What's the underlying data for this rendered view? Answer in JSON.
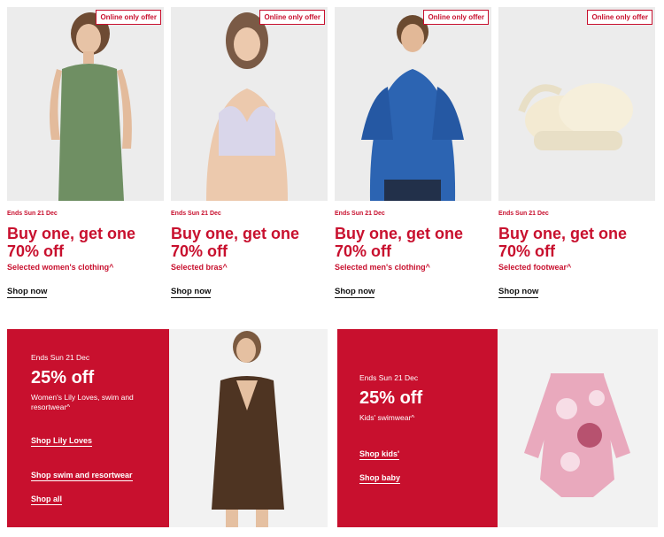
{
  "cards": [
    {
      "badge": "Online only offer",
      "ends": "Ends Sun 21 Dec",
      "headline1": "Buy one, get one",
      "headline2": "70% off",
      "sub": "Selected women's clothing^",
      "cta": "Shop now"
    },
    {
      "badge": "Online only offer",
      "ends": "Ends Sun 21 Dec",
      "headline1": "Buy one, get one",
      "headline2": "70% off",
      "sub": "Selected bras^",
      "cta": "Shop now"
    },
    {
      "badge": "Online only offer",
      "ends": "Ends Sun 21 Dec",
      "headline1": "Buy one, get one",
      "headline2": "70% off",
      "sub": "Selected men's clothing^",
      "cta": "Shop now"
    },
    {
      "badge": "Online only offer",
      "ends": "Ends Sun 21 Dec",
      "headline1": "Buy one, get one",
      "headline2": "70% off",
      "sub": "Selected footwear^",
      "cta": "Shop now"
    }
  ],
  "promo_left": {
    "ends": "Ends Sun 21 Dec",
    "headline": "25% off",
    "desc": "Women's Lily Loves, swim and resortwear^",
    "links": [
      "Shop Lily Loves",
      "Shop swim and resortwear",
      "Shop all"
    ]
  },
  "promo_right": {
    "ends": "Ends Sun 21 Dec",
    "headline": "25% off",
    "desc": "Kids' swimwear^",
    "links": [
      "Shop kids'",
      "Shop baby"
    ]
  },
  "colors": {
    "accent": "#c8102e",
    "image_bg": "#ececec"
  }
}
